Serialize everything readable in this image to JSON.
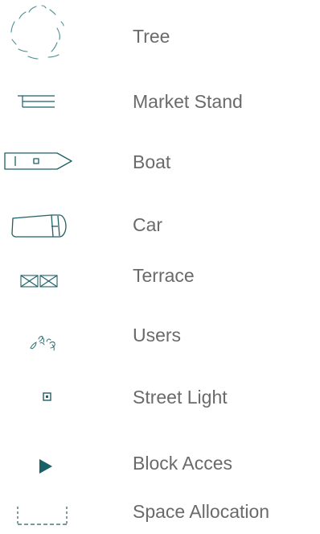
{
  "legend": {
    "items": [
      {
        "symbol": "tree-icon",
        "label": "Tree"
      },
      {
        "symbol": "market-stand-icon",
        "label": "Market Stand"
      },
      {
        "symbol": "boat-icon",
        "label": "Boat"
      },
      {
        "symbol": "car-icon",
        "label": "Car"
      },
      {
        "symbol": "terrace-icon",
        "label": "Terrace"
      },
      {
        "symbol": "users-icon",
        "label": "Users"
      },
      {
        "symbol": "street-light-icon",
        "label": "Street Light"
      },
      {
        "symbol": "block-access-icon",
        "label": "Block Acces"
      },
      {
        "symbol": "space-allocation-icon",
        "label": "Space Allocation"
      }
    ]
  },
  "colors": {
    "symbol_stroke": "#1f5f66",
    "symbol_fill": "#1a6068",
    "label_text": "#6a6a6a",
    "background": "#ffffff"
  }
}
